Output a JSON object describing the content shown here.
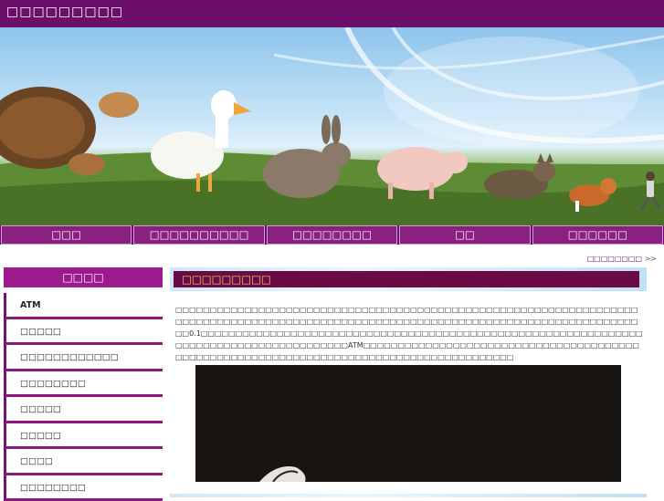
{
  "header": {
    "site_title": "□□□□□□□□□"
  },
  "banner": {
    "description_icons": [
      "tortoise-icon",
      "duck-icon",
      "rabbit-icon",
      "pig-icon",
      "cat-icon",
      "dog-icon",
      "runner-icon"
    ]
  },
  "nav": {
    "items": [
      "□□□",
      "□□□□□□□□□□",
      "□□□□□□□□",
      "□□",
      "□□□□□□"
    ]
  },
  "breadcrumb": {
    "text": "□□□□□□□□",
    "arrow": ">>"
  },
  "sidebar": {
    "title": "□□□□",
    "items": [
      "ATM",
      "□□□□□",
      "□□□□□□□□□□□□",
      "□□□□□□□□",
      "□□□□□",
      "□□□□□",
      "□□□□",
      "□□□□□□□□"
    ]
  },
  "content": {
    "title": "□□□□□□□□□",
    "paragraph": "□□□□□□□□□□□□□□□□□□□□□□□□□□□□□□□□□□□□□□□□□□□□□□□□□□□□□□□□□□□□□□□□□□□□□□□□□□□□□□□□□□□□□□□□□□□□□□□□□□□□□□□□□□□□□□□□□□□□□□□□□□□□□□□□□□□□□□□□0.1□□□□□□□□□□□□□□□□□□□□□□□□□□□□□□□□□□□□□□□□□□□□□□□□□□□□□□□□□□□□□□□□□□□□□□□□□□□□□□□□□□□□□□□□□ATM□□□□□□□□□□□□□□□□□□□□□□□□□□□□□□□□□□□□□□□□□□□□□□□□□□□□□□□□□□□□□□□□□□□□□□□□□□□□□□□□□□□□□□□□□"
  },
  "colors": {
    "primary": "#6b0f6b",
    "nav_item": "#8a2080",
    "title_bar": "#6b0a45",
    "title_text": "#f2d86a"
  }
}
